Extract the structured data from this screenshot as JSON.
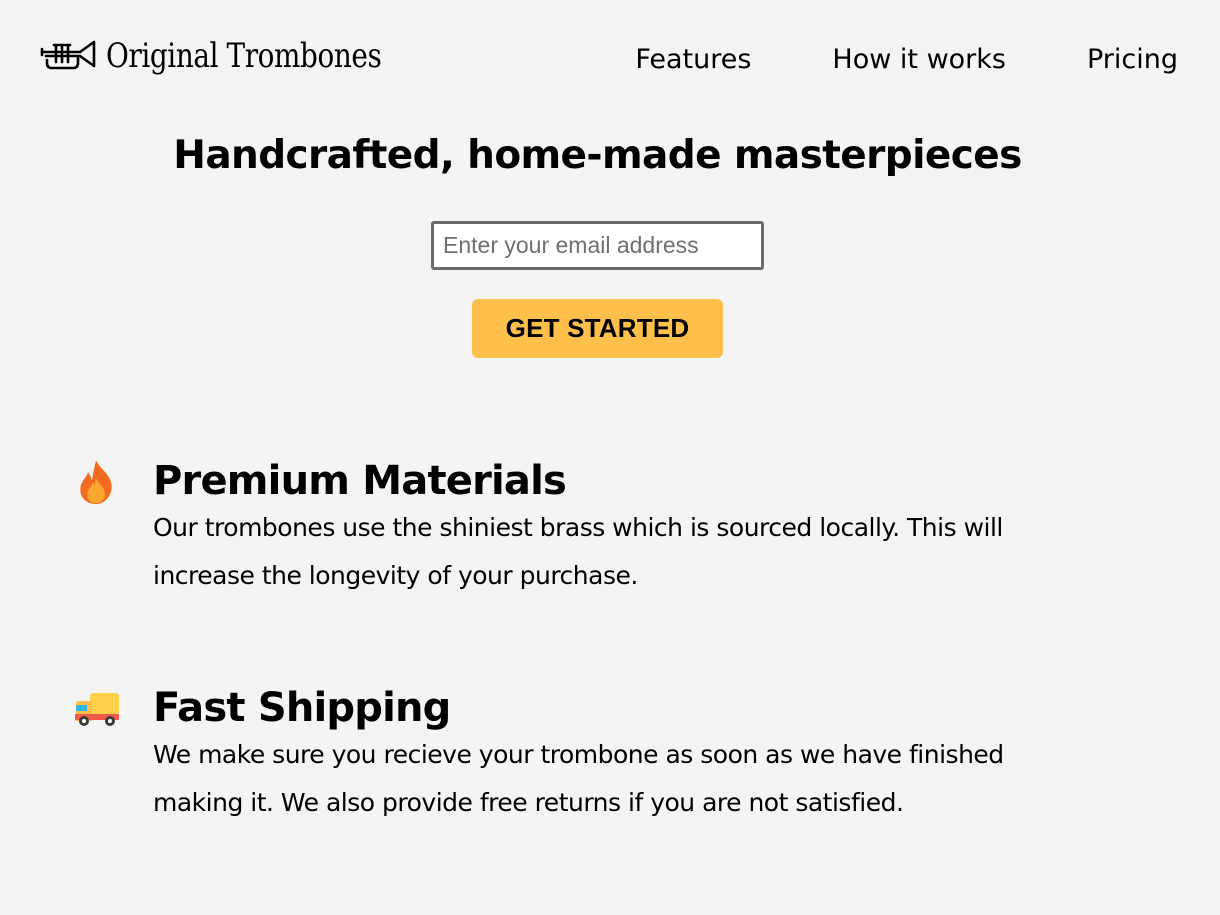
{
  "header": {
    "logo_text": "Original Trombones",
    "logo_icon": "trumpet-icon",
    "nav": [
      {
        "label": "Features"
      },
      {
        "label": "How it works"
      },
      {
        "label": "Pricing"
      }
    ]
  },
  "hero": {
    "title": "Handcrafted, home-made masterpieces",
    "email_placeholder": "Enter your email address",
    "email_value": "",
    "cta_label": "GET STARTED"
  },
  "features": [
    {
      "icon": "fire-icon",
      "title": "Premium Materials",
      "description": "Our trombones use the shiniest brass which is sourced locally. This will increase the longevity of your purchase."
    },
    {
      "icon": "truck-icon",
      "title": "Fast Shipping",
      "description": "We make sure you recieve your trombone as soon as we have finished making it. We also provide free returns if you are not satisfied."
    }
  ],
  "colors": {
    "background": "#f4f4f4",
    "cta": "#fec04b",
    "input_border": "#6a6a6a",
    "fire_outer": "#f26b21",
    "fire_inner": "#fba62f",
    "truck_cargo": "#fdd14a",
    "truck_cab": "#f05a4a",
    "truck_window": "#33b5e8"
  }
}
